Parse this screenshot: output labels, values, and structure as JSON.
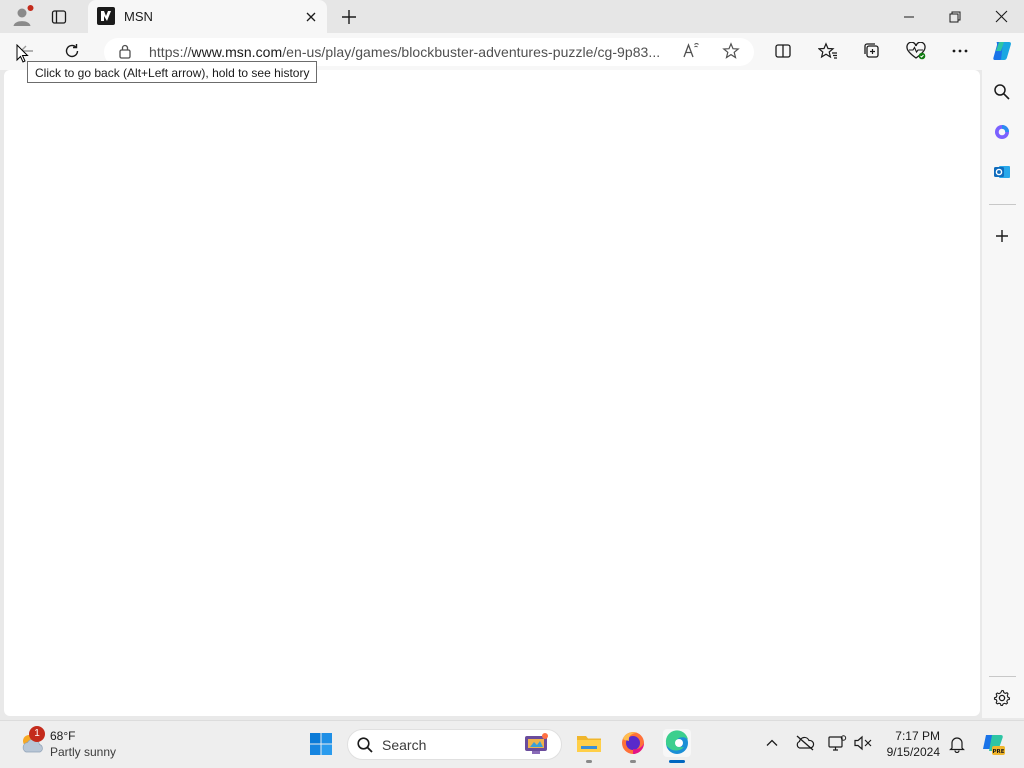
{
  "browser": {
    "tab": {
      "title": "MSN"
    },
    "address": {
      "url_prefix": "https://",
      "url_host": "www.msn.com",
      "url_path": "/en-us/play/games/blockbuster-adventures-puzzle/cg-9p83..."
    },
    "tooltip": "Click to go back (Alt+Left arrow), hold to see history"
  },
  "taskbar": {
    "weather": {
      "temp": "68°F",
      "desc": "Partly sunny",
      "badge": "1"
    },
    "search": {
      "placeholder": "Search"
    },
    "clock": {
      "time": "7:17 PM",
      "date": "9/15/2024"
    }
  },
  "colors": {
    "accent": "#0067c0",
    "profile_dot": "#c42b1c",
    "badge": "#c42b1c"
  }
}
